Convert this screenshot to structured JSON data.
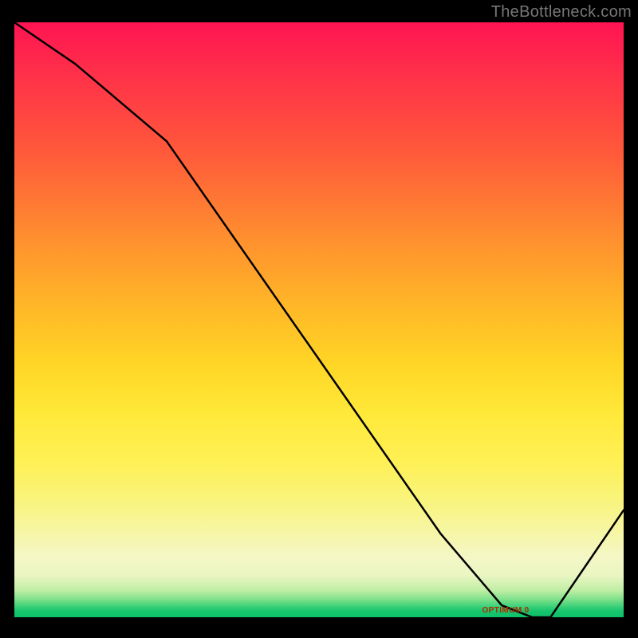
{
  "watermark": "TheBottleneck.com",
  "annotation_label": "OPTIMUM 0",
  "chart_data": {
    "type": "line",
    "title": "",
    "xlabel": "",
    "ylabel": "",
    "xlim": [
      0,
      100
    ],
    "ylim": [
      0,
      100
    ],
    "x": [
      0,
      10,
      25,
      40,
      55,
      70,
      80,
      85,
      88,
      100
    ],
    "values": [
      100,
      93,
      80,
      58,
      36,
      14,
      2,
      0,
      0,
      18
    ],
    "annotation": {
      "label_key": "annotation_label",
      "x": 82,
      "y": 0
    }
  }
}
